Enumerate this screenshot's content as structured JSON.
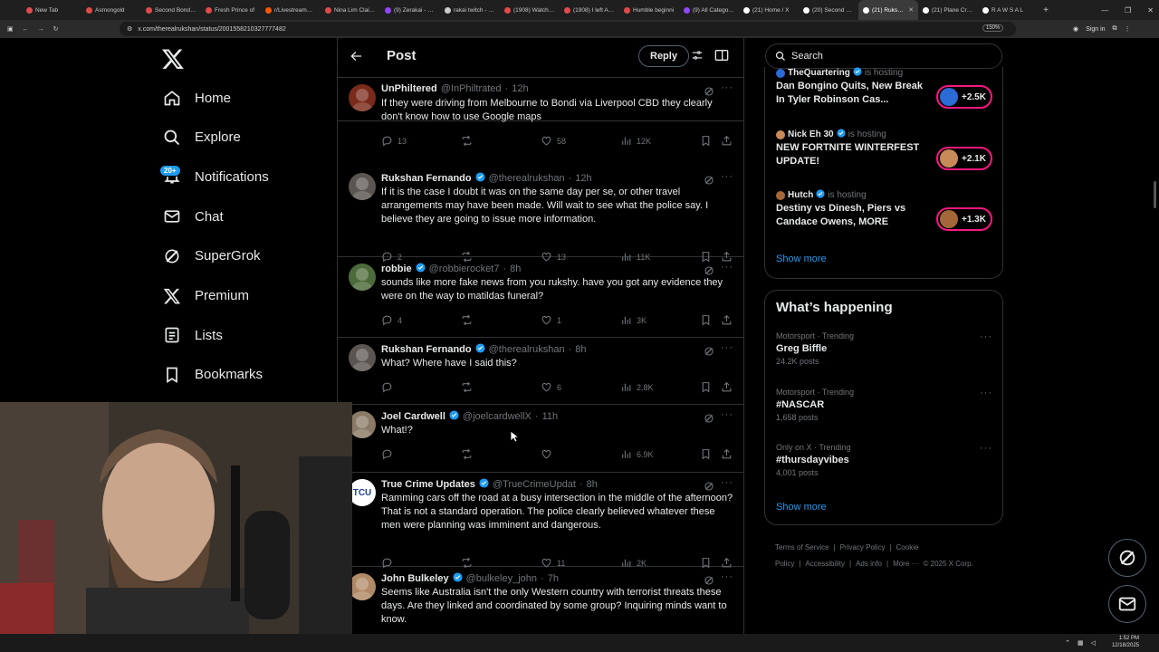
{
  "browser": {
    "tabs": [
      {
        "label": "New Tab",
        "color": "#e24a4a"
      },
      {
        "label": "Asmongold",
        "color": "#e24a4a"
      },
      {
        "label": "Second Bondi T",
        "color": "#e24a4a"
      },
      {
        "label": "Fresh Prince of",
        "color": "#e24a4a"
      },
      {
        "label": "r/LivestreamFail",
        "color": "#ff5700"
      },
      {
        "label": "Nina Lim Claims",
        "color": "#e24a4a"
      },
      {
        "label": "(9) Zerakai - Twit",
        "color": "#9146ff"
      },
      {
        "label": "rakai twitch - Go",
        "color": "#cccccc"
      },
      {
        "label": "(1908) Watch lat",
        "color": "#e24a4a"
      },
      {
        "label": "(1908) I left Auth",
        "color": "#e24a4a"
      },
      {
        "label": "Humble beginni",
        "color": "#e24a4a"
      },
      {
        "label": "(9) All Categorie",
        "color": "#9146ff"
      },
      {
        "label": "(21) Home / X",
        "color": "#ffffff"
      },
      {
        "label": "(20) Second Bon",
        "color": "#ffffff"
      },
      {
        "label": "(21) Rukshan",
        "color": "#ffffff",
        "active": true
      },
      {
        "label": "(21) Plane Crash",
        "color": "#ffffff"
      },
      {
        "label": "R A W S A L",
        "color": "#ffffff"
      }
    ],
    "url": "x.com/therealrukshan/status/2001558210327777482",
    "zoom": "150%",
    "sign_in": "Sign in",
    "newtab_symbol": "+",
    "win_min": "—",
    "win_max": "❐",
    "win_close": "✕"
  },
  "nav": {
    "items": [
      {
        "label": "Home",
        "icon": "home-icon"
      },
      {
        "label": "Explore",
        "icon": "search-icon"
      },
      {
        "label": "Notifications",
        "icon": "bell-icon"
      },
      {
        "label": "Chat",
        "icon": "mail-icon"
      },
      {
        "label": "SuperGrok",
        "icon": "grok-icon"
      },
      {
        "label": "Premium",
        "icon": "x-icon"
      },
      {
        "label": "Lists",
        "icon": "list-icon"
      },
      {
        "label": "Bookmarks",
        "icon": "bookmark-icon"
      }
    ],
    "notifications_badge": "20+"
  },
  "post": {
    "title": "Post",
    "reply_button": "Reply"
  },
  "tweets": [
    {
      "name": "UnPhiltered",
      "handle": "@InPhiltrated",
      "time": "12h",
      "verified": false,
      "text": "If they were driving from Melbourne to Bondi via Liverpool CBD they clearly don't know how to use  Google maps",
      "replies": "13",
      "likes": "58",
      "views": "12K",
      "avatar_color": "#7a2a1a"
    },
    {
      "name": "Rukshan Fernando",
      "handle": "@therealrukshan",
      "time": "12h",
      "verified": true,
      "text": "If it is the case I doubt it was on the same day per se, or other travel arrangements may have been made. Will wait to see what the police say. I believe they are going to issue more information.",
      "replies": "2",
      "likes": "13",
      "views": "11K",
      "avatar_color": "#5a5550"
    },
    {
      "name": "robbie",
      "handle": "@robbierocket7",
      "time": "8h",
      "verified": true,
      "text": "sounds like more fake news from you rukshy. have you got any evidence they were on the way to matildas funeral?",
      "replies": "4",
      "likes": "1",
      "views": "3K",
      "avatar_color": "#4d6b3a"
    },
    {
      "name": "Rukshan Fernando",
      "handle": "@therealrukshan",
      "time": "8h",
      "verified": true,
      "text": "What? Where have I said this?",
      "replies": "",
      "likes": "6",
      "views": "2.8K",
      "avatar_color": "#5a5550"
    },
    {
      "name": "Joel Cardwell",
      "handle": "@joelcardwellX",
      "time": "11h",
      "verified": true,
      "text": "What!?",
      "replies": "",
      "likes": "",
      "views": "6.9K",
      "avatar_color": "#8a7a66"
    },
    {
      "name": "True Crime Updates",
      "handle": "@TrueCrimeUpdat",
      "time": "8h",
      "verified": true,
      "text": "Ramming cars off the road at a busy intersection in the middle of the afternoon? That is not a standard operation. The police clearly believed whatever these men were planning was imminent and dangerous.",
      "replies": "",
      "likes": "11",
      "views": "2K",
      "avatar_color": "#ffffff",
      "avatar_text": "TCU"
    },
    {
      "name": "John Bulkeley",
      "handle": "@bulkeley_john",
      "time": "7h",
      "verified": true,
      "text": "Seems like Australia isn't the only Western country with terrorist threats these days. Are they linked and coordinated by some group? Inquiring minds want to know.",
      "replies": "",
      "likes": "",
      "views": "",
      "avatar_color": "#b08a66"
    }
  ],
  "search": {
    "placeholder": "Search"
  },
  "spaces": [
    {
      "host": "TheQuartering",
      "status": "is hosting",
      "title": "Dan Bongino Quits, New Break In Tyler Robinson Cas...",
      "count": "+2.5K",
      "avatar_color": "#2a6bd6"
    },
    {
      "host": "Nick Eh 30",
      "status": "is hosting",
      "title": "NEW FORTNITE WINTERFEST UPDATE!",
      "count": "+2.1K",
      "avatar_color": "#c98a5a"
    },
    {
      "host": "Hutch",
      "status": "is hosting",
      "title": "Destiny vs Dinesh, Piers vs Candace Owens, MORE",
      "count": "+1.3K",
      "avatar_color": "#a5673a"
    }
  ],
  "spaces_show_more": "Show more",
  "happening": {
    "title": "What’s happening",
    "trends": [
      {
        "context": "Motorsport · Trending",
        "name": "Greg Biffle",
        "count": "24.2K posts"
      },
      {
        "context": "Motorsport · Trending",
        "name": "#NASCAR",
        "count": "1,658 posts"
      },
      {
        "context": "Only on X · Trending",
        "name": "#thursdayvibes",
        "count": "4,001 posts"
      }
    ],
    "show_more": "Show more"
  },
  "footer": {
    "links": [
      "Terms of Service",
      "|",
      "Privacy Policy",
      "|",
      "Cookie Policy",
      "|",
      "Accessibility",
      "|",
      "Ads info",
      "|",
      "More ···",
      "© 2025 X Corp."
    ]
  },
  "taskbar": {
    "time": "1:52 PM",
    "date": "12/18/2025"
  },
  "colors": {
    "accent": "#1d9bf0",
    "live": "#f91880",
    "border": "#2f3336",
    "muted": "#71767b"
  }
}
